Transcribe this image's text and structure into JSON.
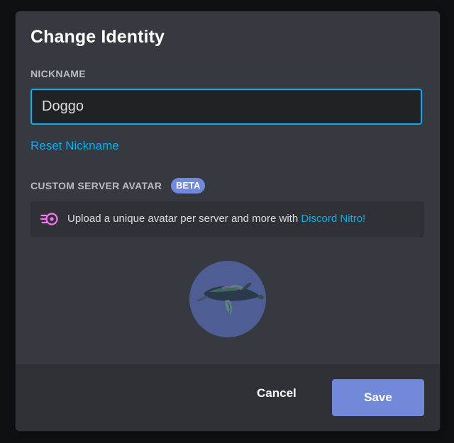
{
  "modal": {
    "title": "Change Identity"
  },
  "nickname": {
    "label": "Nickname",
    "value": "Doggo",
    "reset_label": "Reset Nickname"
  },
  "avatar_section": {
    "label": "Custom Server Avatar",
    "badge": "BETA",
    "nitro_text": "Upload a unique avatar per server and more with ",
    "nitro_link": "Discord Nitro!",
    "nitro_icon": "nitro-icon",
    "avatar_icon": "turtle-avatar"
  },
  "footer": {
    "cancel_label": "Cancel",
    "save_label": "Save"
  },
  "colors": {
    "accent": "#00b0f4",
    "blurple": "#7289da",
    "nitro_pink": "#ff73fa",
    "background": "#36393f",
    "footer": "#2f3136"
  }
}
